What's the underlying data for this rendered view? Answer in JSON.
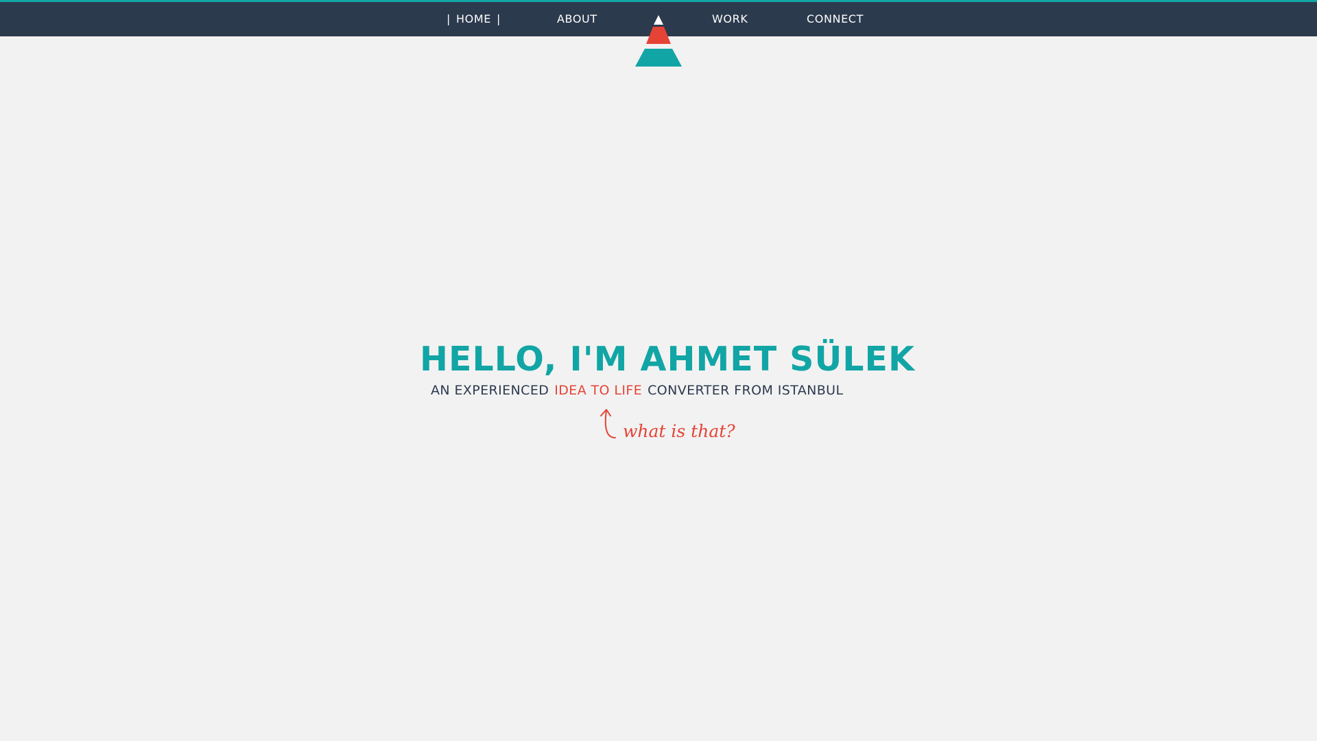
{
  "nav": {
    "home_label": "HOME",
    "about_label": "ABOUT",
    "work_label": "WORK",
    "connect_label": "CONNECT",
    "active_marker": "|"
  },
  "logo": {
    "icon": "triangle-logo-icon",
    "colors": {
      "top": "#ffffff",
      "middle": "#e54335",
      "bottom": "#12a5a5"
    }
  },
  "hero": {
    "title": "HELLO, I'M AHMET SÜLEK",
    "subtitle_before": "AN EXPERIENCED",
    "subtitle_highlight": "IDEA TO LIFE",
    "subtitle_after": "CONVERTER FROM ISTANBUL"
  },
  "annotation": {
    "text": "what is that?",
    "icon": "curved-arrow-icon"
  },
  "colors": {
    "nav_background": "#2c3a4e",
    "accent_teal": "#12a5a5",
    "accent_red": "#e54335",
    "page_background": "#f2f2f2",
    "text_dark": "#2c3a4e"
  }
}
